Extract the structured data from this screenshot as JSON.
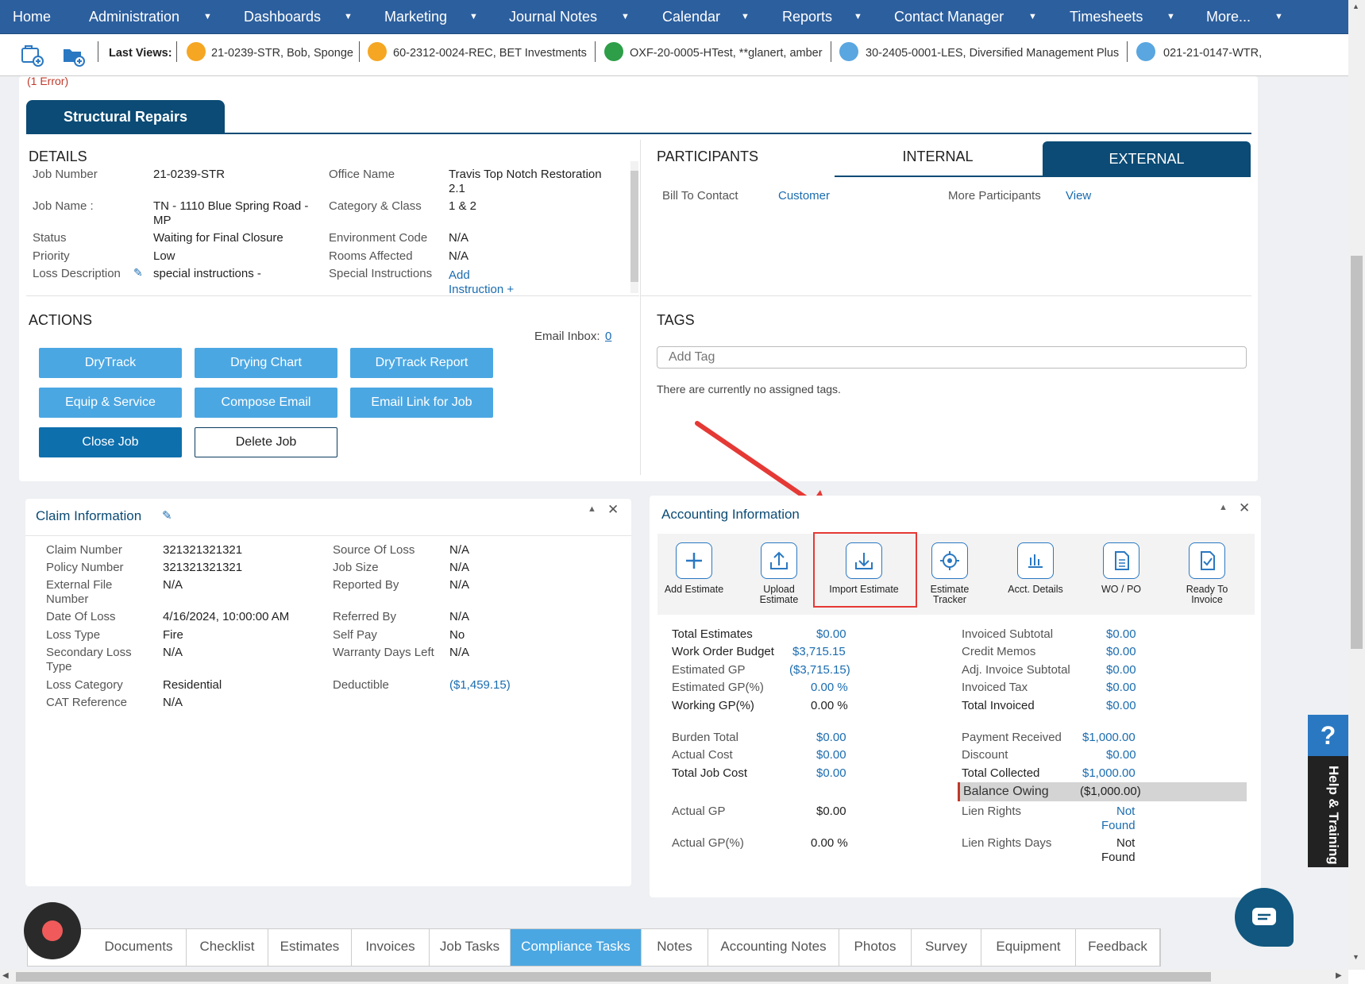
{
  "nav": {
    "home": "Home",
    "administration": "Administration",
    "dashboards": "Dashboards",
    "marketing": "Marketing",
    "journal": "Journal Notes",
    "calendar": "Calendar",
    "reports": "Reports",
    "contacts": "Contact Manager",
    "timesheets": "Timesheets",
    "more": "More..."
  },
  "lastviews": {
    "label": "Last Views:",
    "items": [
      "21-0239-STR, Bob, Sponge",
      "60-2312-0024-REC, BET Investments",
      "OXF-20-0005-HTest, **glanert, amber",
      "30-2405-0001-LES, Diversified Management Plus",
      "021-21-0147-WTR,"
    ]
  },
  "error": "(1 Error)",
  "job_tab": "Structural Repairs",
  "details": {
    "title": "DETAILS",
    "job_number_label": "Job Number",
    "job_number": "21-0239-STR",
    "job_name_label": "Job Name :",
    "job_name_1": "TN - 1110 Blue Spring Road -",
    "job_name_2": "MP",
    "status_label": "Status",
    "status": "Waiting for Final Closure",
    "priority_label": "Priority",
    "priority": "Low",
    "loss_label": "Loss Description",
    "loss": "special instructions -",
    "office_label": "Office Name",
    "office_1": "Travis Top Notch Restoration",
    "office_2": "2.1",
    "category_label": "Category & Class",
    "category": "1 & 2",
    "env_label": "Environment Code",
    "env": "N/A",
    "rooms_label": "Rooms Affected",
    "rooms": "N/A",
    "special_label": "Special Instructions",
    "add_instr_1": "Add",
    "add_instr_2": "Instruction +"
  },
  "participants": {
    "title": "PARTICIPANTS",
    "internal": "INTERNAL",
    "external": "EXTERNAL",
    "bill_label": "Bill To Contact",
    "bill": "Customer",
    "more_label": "More Participants",
    "more": "View"
  },
  "actions": {
    "title": "ACTIONS",
    "inbox_label": "Email Inbox:",
    "inbox": "0",
    "drytrack": "DryTrack",
    "drying": "Drying Chart",
    "report": "DryTrack Report",
    "equip": "Equip & Service",
    "compose": "Compose Email",
    "emaillink": "Email Link for Job",
    "close": "Close Job",
    "delete": "Delete Job"
  },
  "tags": {
    "title": "TAGS",
    "placeholder": "Add Tag",
    "empty": "There are currently no assigned tags."
  },
  "claim": {
    "title": "Claim Information",
    "claim_number_label": "Claim Number",
    "claim_number": "321321321321",
    "policy_label": "Policy Number",
    "policy": "321321321321",
    "external_1": "External File",
    "external_2": "Number",
    "external": "N/A",
    "date_label": "Date Of Loss",
    "date": "4/16/2024, 10:00:00 AM",
    "losstype_label": "Loss Type",
    "losstype": "Fire",
    "sec_1": "Secondary Loss",
    "sec_2": "Type",
    "sec": "N/A",
    "losscat_label": "Loss Category",
    "losscat": "Residential",
    "cat_label": "CAT Reference",
    "cat": "N/A",
    "source_label": "Source Of Loss",
    "source": "N/A",
    "size_label": "Job Size",
    "size": "N/A",
    "reported_label": "Reported By",
    "reported": "N/A",
    "referred_label": "Referred By",
    "referred": "N/A",
    "selfpay_label": "Self Pay",
    "selfpay": "No",
    "warranty_label": "Warranty Days Left",
    "warranty": "N/A",
    "deductible_label": "Deductible",
    "deductible": "($1,459.15)"
  },
  "accounting": {
    "title": "Accounting Information",
    "icons": {
      "add": "Add Estimate",
      "upload_1": "Upload",
      "upload_2": "Estimate",
      "import": "Import Estimate",
      "tracker_1": "Estimate",
      "tracker_2": "Tracker",
      "acct": "Acct. Details",
      "wo": "WO / PO",
      "ready_1": "Ready To",
      "ready_2": "Invoice"
    },
    "rows": {
      "total_est_l": "Total Estimates",
      "total_est": "$0.00",
      "wob_l": "Work Order Budget",
      "wob": "$3,715.15",
      "egp_l": "Estimated GP",
      "egp": "($3,715.15)",
      "egpp_l": "Estimated GP(%)",
      "egpp": "0.00 %",
      "wgp_l": "Working GP(%)",
      "wgp": "0.00 %",
      "burden_l": "Burden Total",
      "burden": "$0.00",
      "actual_l": "Actual Cost",
      "actual": "$0.00",
      "tjc_l": "Total Job Cost",
      "tjc": "$0.00",
      "agp_l": "Actual GP",
      "agp": "$0.00",
      "agpp_l": "Actual GP(%)",
      "agpp": "0.00 %",
      "isub_l": "Invoiced Subtotal",
      "isub": "$0.00",
      "credit_l": "Credit Memos",
      "credit": "$0.00",
      "adj_l": "Adj. Invoice Subtotal",
      "adj": "$0.00",
      "itax_l": "Invoiced Tax",
      "itax": "$0.00",
      "tinv_l": "Total Invoiced",
      "tinv": "$0.00",
      "pay_l": "Payment Received",
      "pay": "$1,000.00",
      "disc_l": "Discount",
      "disc": "$0.00",
      "tcol_l": "Total Collected",
      "tcol": "$1,000.00",
      "bal_l": "Balance Owing",
      "bal": "($1,000.00)",
      "lien_l": "Lien Rights",
      "lien_1": "Not",
      "lien_2": "Found",
      "liend_l": "Lien Rights Days",
      "liend_1": "Not",
      "liend_2": "Found"
    }
  },
  "bottom_tabs": [
    "Documents",
    "Checklist",
    "Estimates",
    "Invoices",
    "Job Tasks",
    "Compliance Tasks",
    "Notes",
    "Accounting Notes",
    "Photos",
    "Survey",
    "Equipment",
    "Feedback"
  ],
  "help": {
    "q": "?",
    "label": "Help & Training"
  },
  "colors": {
    "nav": "#2c5f9e",
    "accent": "#0b4b75",
    "button": "#4ba7e2",
    "link": "#1a6cb0",
    "highlight": "#e53935"
  }
}
